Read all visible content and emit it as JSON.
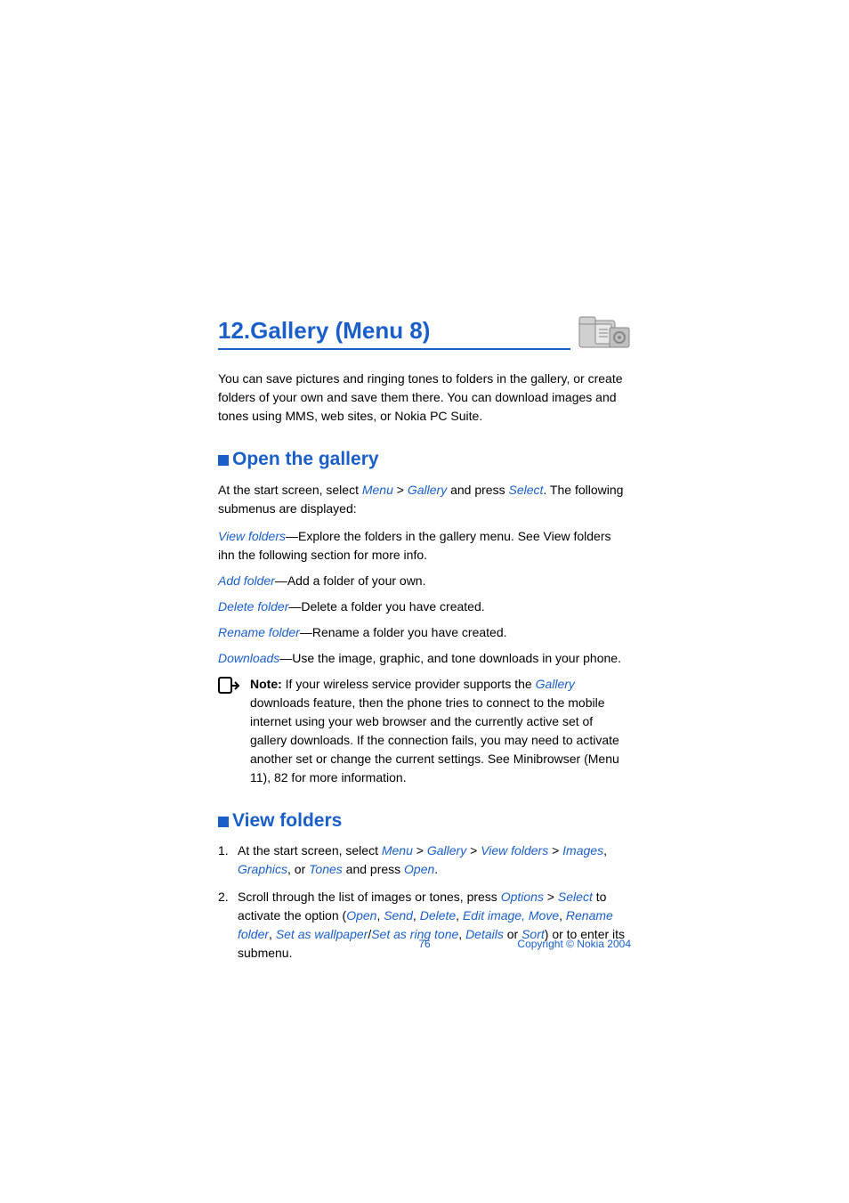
{
  "chapter": {
    "title": "12.Gallery (Menu 8)",
    "icon_name": "gallery-folder-icon"
  },
  "intro": "You can save pictures and ringing tones to folders in the gallery, or create folders of your own and save them there. You can download images and tones using MMS, web sites, or Nokia PC Suite.",
  "section_open": {
    "title": "Open the gallery",
    "lead_pre": "At the start screen, select ",
    "menu": "Menu",
    "gt1": " > ",
    "gallery": "Gallery",
    "and_press": " and press ",
    "select": "Select",
    "lead_post": ". The following submenus are displayed:",
    "items": {
      "view_folders_term": "View folders",
      "view_folders_desc": "—Explore the folders in the gallery menu. See View folders ihn the following section for more info.",
      "add_folder_term": "Add folder",
      "add_folder_desc": "—Add a folder of your own.",
      "delete_folder_term": "Delete folder",
      "delete_folder_desc": "—Delete a folder you have created.",
      "rename_folder_term": "Rename folder",
      "rename_folder_desc": "—Rename a folder you have created.",
      "downloads_term": "Downloads",
      "downloads_desc": "—Use the image, graphic, and tone downloads in your phone."
    },
    "note": {
      "label": "Note:",
      "pre": " If your wireless service provider supports the ",
      "gallery": "Gallery",
      "post": " downloads feature, then the phone tries to connect to the mobile internet using your web browser and the currently active set of gallery downloads. If the connection fails, you may need to activate another set or change the current settings. See Minibrowser (Menu 11), 82 for more information."
    }
  },
  "section_view": {
    "title": "View folders",
    "step1": {
      "pre": "At the start screen, select ",
      "menu": "Menu",
      "gt1": " > ",
      "gallery": "Gallery",
      "gt2": " > ",
      "view_folders": "View folders",
      "gt3": " > ",
      "images": "Images",
      "comma1": ", ",
      "graphics": "Graphics",
      "or": ", or ",
      "tones": "Tones",
      "and_press": " and press ",
      "open": "Open",
      "period": "."
    },
    "step2": {
      "pre": "Scroll through the list of images or tones, press ",
      "options": "Options",
      "gt1": " > ",
      "select": "Select",
      "mid": " to activate the option (",
      "open": "Open",
      "c1": ", ",
      "send": "Send",
      "c2": ", ",
      "delete": "Delete",
      "c3": ", ",
      "edit": "Edit image, Move",
      "c4": ", ",
      "rename": "Rename folder",
      "c5": ", ",
      "wallpaper": "Set as wallpaper",
      "slash": "/",
      "ringtone": "Set as ring tone",
      "c6": ", ",
      "details": "Details",
      "or": " or ",
      "sort": "Sort",
      "post": ") or to enter its submenu."
    }
  },
  "footer": {
    "page": "76",
    "copyright": "Copyright © Nokia 2004"
  }
}
